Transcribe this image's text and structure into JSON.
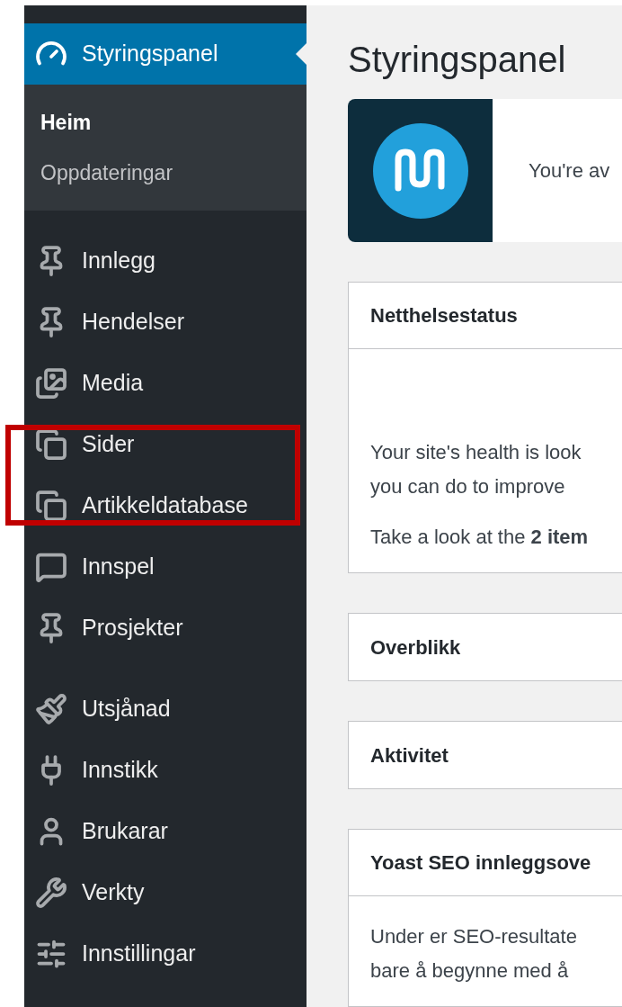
{
  "sidebar": {
    "active": {
      "label": "Styringspanel",
      "selected": true
    },
    "submenu": [
      {
        "label": "Heim",
        "selected": true
      },
      {
        "label": "Oppdateringar",
        "selected": false
      }
    ],
    "groups": [
      [
        {
          "label": "Innlegg"
        },
        {
          "label": "Hendelser"
        },
        {
          "label": "Media"
        },
        {
          "label": "Sider"
        },
        {
          "label": "Artikkeldatabase"
        },
        {
          "label": "Innspel"
        },
        {
          "label": "Prosjekter"
        }
      ],
      [
        {
          "label": "Utsjånad"
        },
        {
          "label": "Innstikk"
        },
        {
          "label": "Brukarar"
        },
        {
          "label": "Verkty"
        },
        {
          "label": "Innstillingar"
        }
      ]
    ]
  },
  "page_title": "Styringspanel",
  "banner": {
    "text": "You're av"
  },
  "panels": [
    {
      "title": "Netthelsestatus",
      "paragraphs": [
        [
          "Your site's health is look",
          "you can do to improve"
        ],
        [
          "Take a look at the **2 item**"
        ]
      ]
    },
    {
      "title": "Overblikk"
    },
    {
      "title": "Aktivitet"
    },
    {
      "title": "Yoast SEO innleggsove",
      "paragraphs": [
        [
          "Under er SEO-resultate",
          "bare å begynne med å"
        ]
      ]
    }
  ]
}
